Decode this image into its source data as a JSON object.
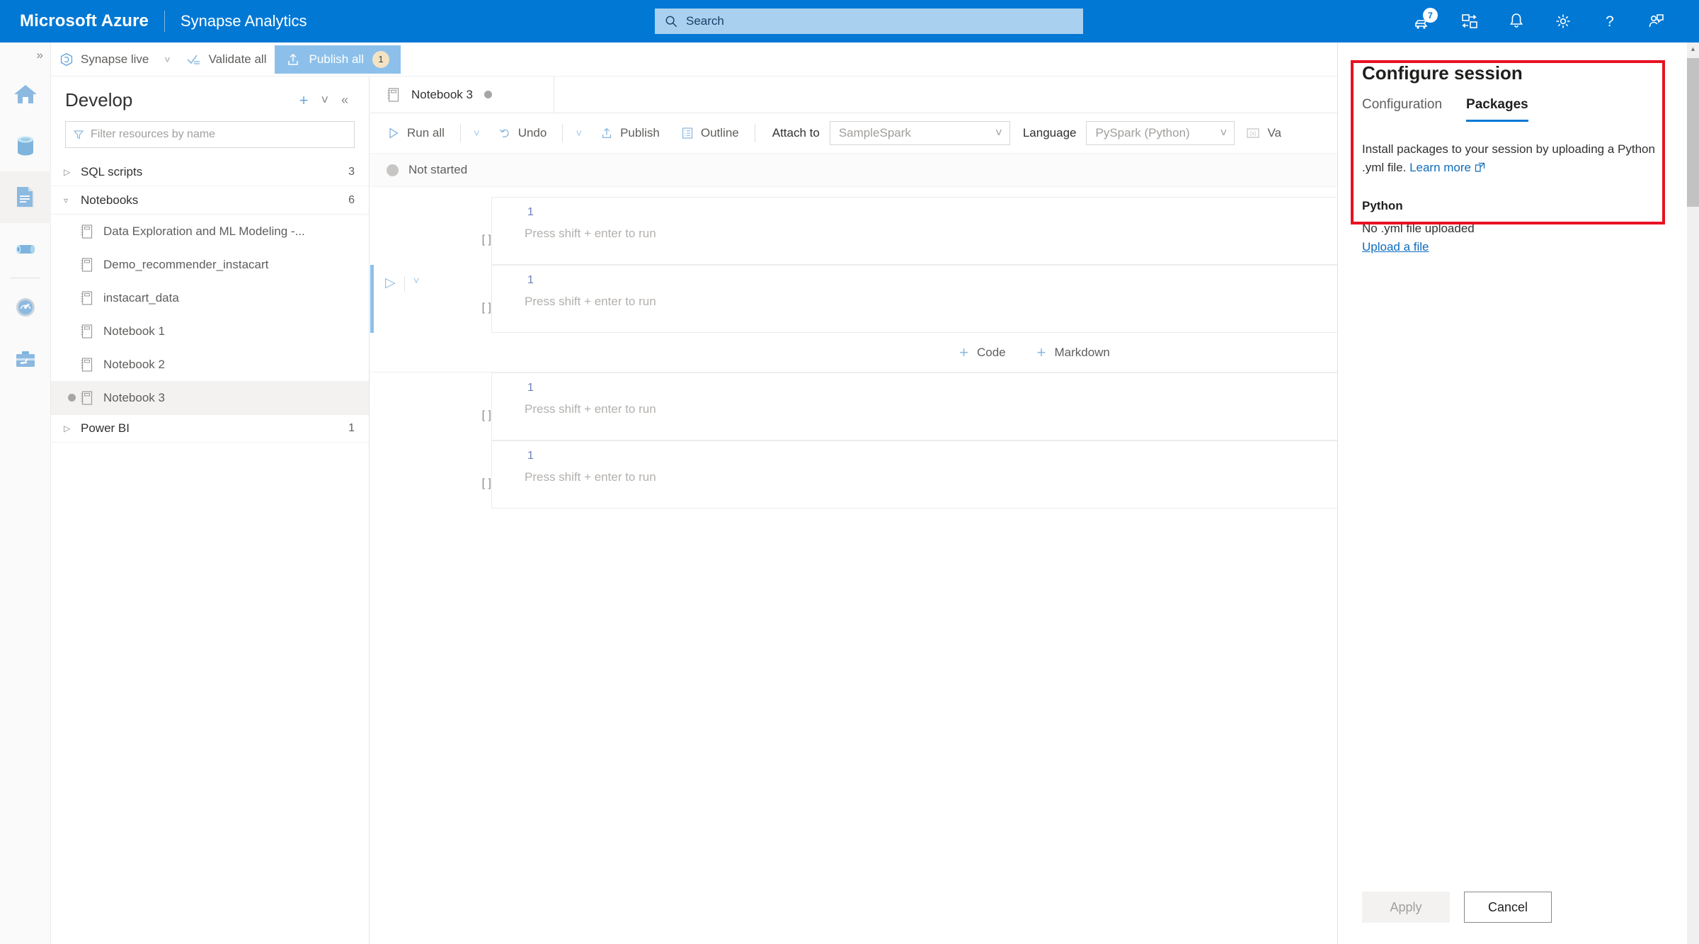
{
  "header": {
    "brand": "Microsoft Azure",
    "service": "Synapse Analytics",
    "search_placeholder": "Search",
    "icons": [
      {
        "name": "cloud-shell-icon",
        "badge": "7"
      },
      {
        "name": "directories-subscriptions-icon",
        "badge": ""
      },
      {
        "name": "notifications-bell-icon",
        "badge": ""
      },
      {
        "name": "settings-gear-icon",
        "badge": ""
      },
      {
        "name": "help-question-icon",
        "badge": ""
      },
      {
        "name": "feedback-person-icon",
        "badge": ""
      }
    ]
  },
  "activity_bar": {
    "expand_label": "»",
    "items": [
      {
        "name": "home",
        "selected": false
      },
      {
        "name": "data",
        "selected": false
      },
      {
        "name": "develop",
        "selected": true
      },
      {
        "name": "integrate",
        "selected": false
      },
      {
        "name": "monitor",
        "selected": false
      },
      {
        "name": "manage",
        "selected": false
      }
    ]
  },
  "command_bar": {
    "source_control": "Synapse live",
    "validate_all": "Validate all",
    "publish_all": "Publish all",
    "publish_all_count": "1"
  },
  "explorer": {
    "title": "Develop",
    "add_label": "+",
    "collapse_all_label": "˅",
    "hide_label": "«",
    "filter_placeholder": "Filter resources by name",
    "tree": [
      {
        "type": "group",
        "label": "SQL scripts",
        "count": "3",
        "expanded": false
      },
      {
        "type": "group",
        "label": "Notebooks",
        "count": "6",
        "expanded": true
      },
      {
        "type": "leaf",
        "label": "Data Exploration and ML Modeling -...",
        "selected": false,
        "dirty": false
      },
      {
        "type": "leaf",
        "label": "Demo_recommender_instacart",
        "selected": false,
        "dirty": false
      },
      {
        "type": "leaf",
        "label": "instacart_data",
        "selected": false,
        "dirty": false
      },
      {
        "type": "leaf",
        "label": "Notebook 1",
        "selected": false,
        "dirty": false
      },
      {
        "type": "leaf",
        "label": "Notebook 2",
        "selected": false,
        "dirty": false
      },
      {
        "type": "leaf",
        "label": "Notebook 3",
        "selected": true,
        "dirty": true
      },
      {
        "type": "group",
        "label": "Power BI",
        "count": "1",
        "expanded": false
      }
    ]
  },
  "notebook": {
    "tab_label": "Notebook 3",
    "toolbar": {
      "run_all": "Run all",
      "undo": "Undo",
      "publish": "Publish",
      "outline": "Outline",
      "attach_to_label": "Attach to",
      "attach_to_value": "SampleSpark",
      "language_label": "Language",
      "language_value": "PySpark (Python)",
      "variables": "Va"
    },
    "status": "Not started",
    "insert": {
      "code": "Code",
      "markdown": "Markdown"
    },
    "cells": [
      {
        "exec": "[ ]",
        "lineno": "1",
        "placeholder": "Press shift + enter to run",
        "active": false
      },
      {
        "exec": "[ ]",
        "lineno": "1",
        "placeholder": "Press shift + enter to run",
        "active": true
      },
      {
        "exec": "[ ]",
        "lineno": "1",
        "placeholder": "Press shift + enter to run",
        "active": false
      },
      {
        "exec": "[ ]",
        "lineno": "1",
        "placeholder": "Press shift + enter to run",
        "active": false
      }
    ]
  },
  "configure_session": {
    "title": "Configure session",
    "tabs": [
      {
        "label": "Configuration",
        "active": false
      },
      {
        "label": "Packages",
        "active": true
      }
    ],
    "description_before_link": "Install packages to your session by uploading a Python .yml file. ",
    "learn_more": "Learn more",
    "python_heading": "Python",
    "no_file_text": "No .yml file uploaded",
    "upload_link": "Upload a file",
    "apply_label": "Apply",
    "cancel_label": "Cancel"
  },
  "colors": {
    "azure_blue": "#0078d4",
    "highlight_red": "#e81123",
    "accent_light_blue": "#8cc0ea",
    "link_blue": "#0f6cbd"
  }
}
